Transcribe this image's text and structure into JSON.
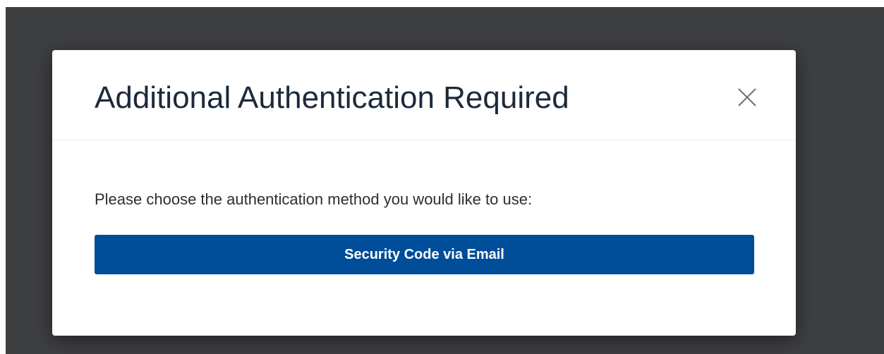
{
  "modal": {
    "title": "Additional Authentication Required",
    "close_icon": "close-icon",
    "prompt": "Please choose the authentication method you would like to use:",
    "methods": [
      {
        "label": "Security Code via Email"
      }
    ]
  },
  "colors": {
    "backdrop": "#3d3e40",
    "primary_button": "#004d99",
    "title_text": "#1c2a3a"
  }
}
